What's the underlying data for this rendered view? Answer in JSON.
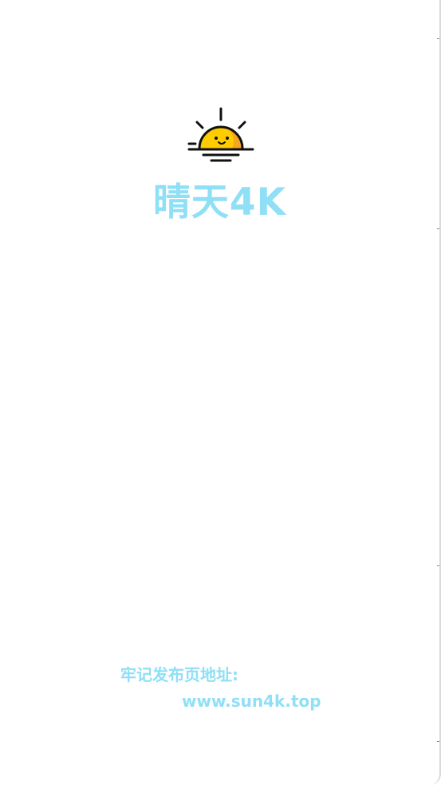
{
  "splash": {
    "app_name": "晴天4K",
    "notice_label": "牢记发布页地址:",
    "notice_url": "www.sun4k.top",
    "logo_icon": "sunrise-icon",
    "colors": {
      "brand_text": "#8fdff6",
      "sun_fill": "#ffcc00",
      "sun_shade": "#f5a623",
      "line": "#111111",
      "background": "#ffffff"
    }
  }
}
